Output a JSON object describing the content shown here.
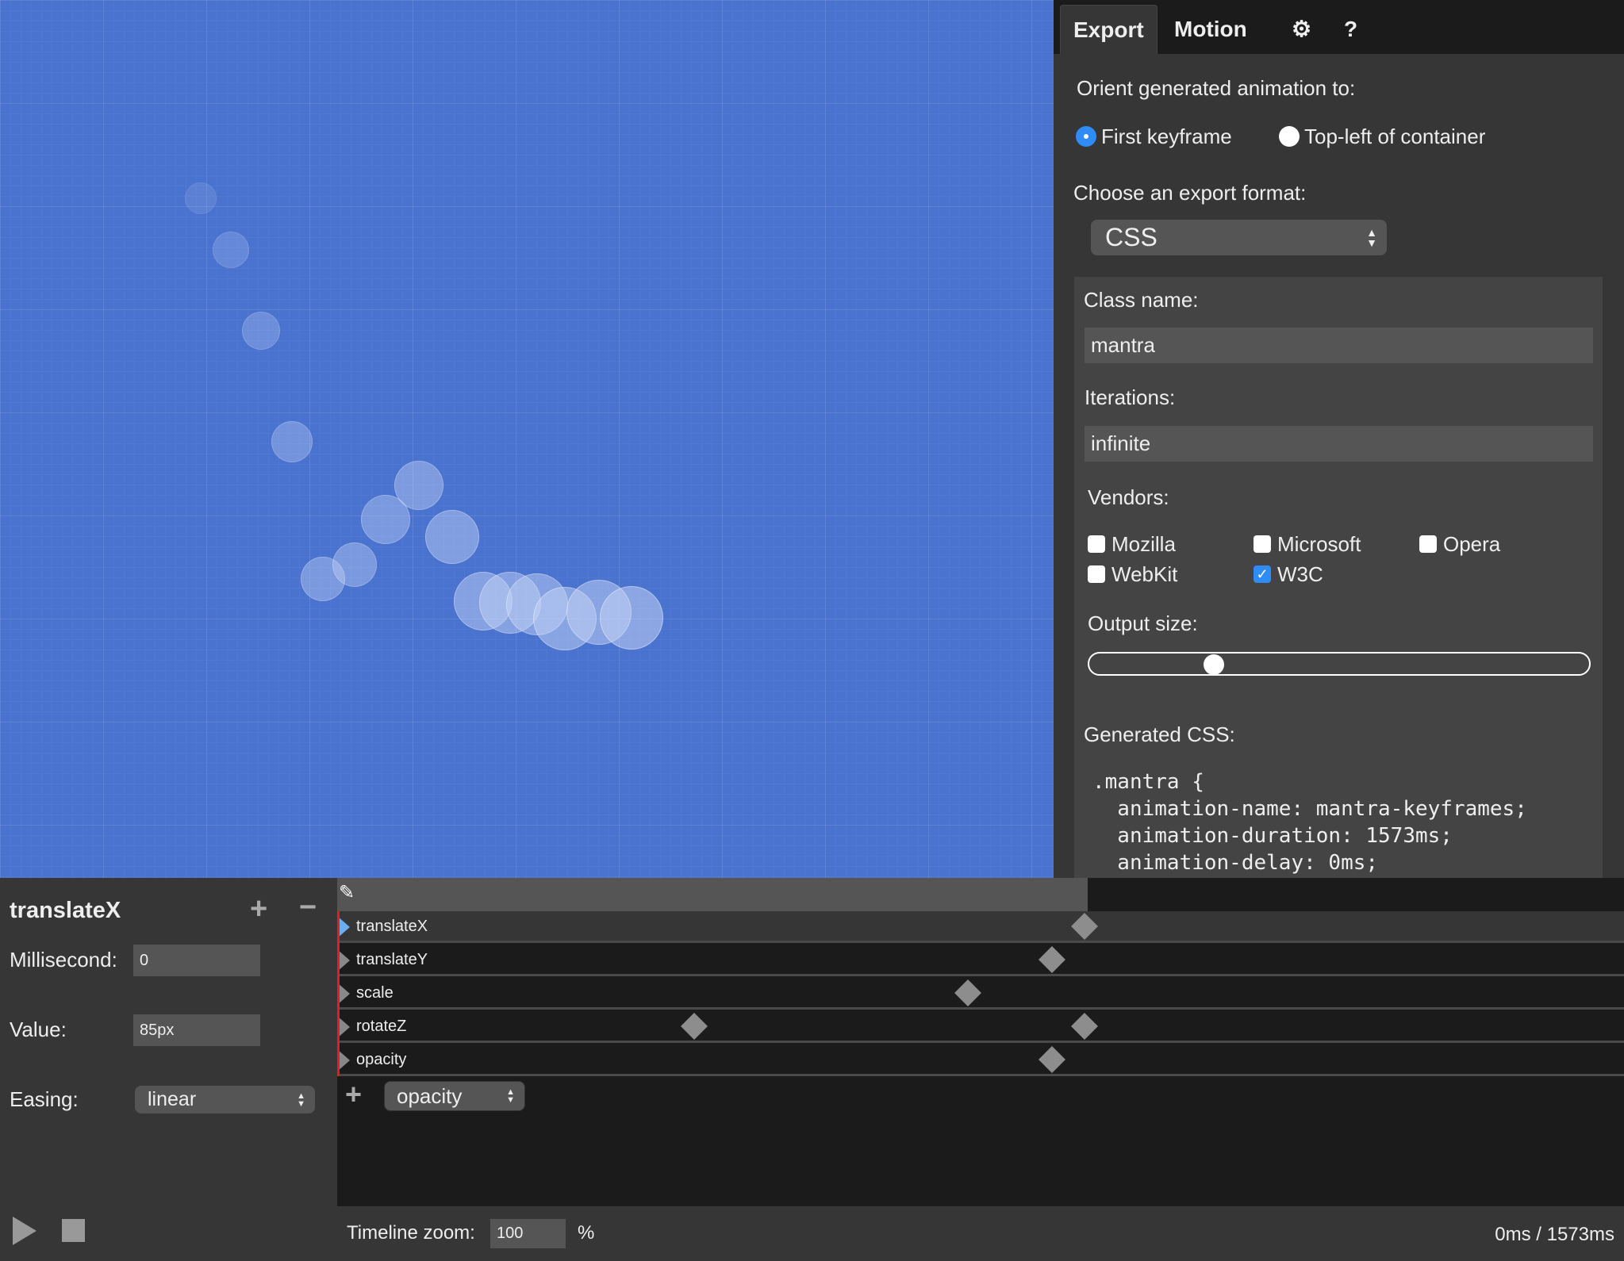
{
  "tabs": [
    {
      "label": "Export",
      "active": true
    },
    {
      "label": "Motion"
    },
    {
      "icon": "gear-icon"
    },
    {
      "label": "?"
    }
  ],
  "export": {
    "orient_label": "Orient generated animation to:",
    "orient_options": [
      {
        "label": "First keyframe",
        "checked": true
      },
      {
        "label": "Top-left of container",
        "checked": false
      }
    ],
    "format_label": "Choose an export format:",
    "format_value": "CSS",
    "class_label": "Class name:",
    "class_value": "mantra",
    "iterations_label": "Iterations:",
    "iterations_value": "infinite",
    "vendors_label": "Vendors:",
    "vendors": [
      {
        "label": "Mozilla",
        "checked": false
      },
      {
        "label": "Microsoft",
        "checked": false
      },
      {
        "label": "Opera",
        "checked": false
      },
      {
        "label": "WebKit",
        "checked": false
      },
      {
        "label": "W3C",
        "checked": true
      }
    ],
    "output_size_label": "Output size:",
    "output_size_fraction": 0.25,
    "generated_label": "Generated CSS:",
    "code_lines": [
      ".mantra {",
      "  animation-name: mantra-keyframes;",
      "  animation-duration: 1573ms;",
      "  animation-delay: 0ms;"
    ]
  },
  "keyframe_editor": {
    "title": "translateX",
    "ms_label": "Millisecond:",
    "ms_value": "0",
    "value_label": "Value:",
    "value_value": "85px",
    "easing_label": "Easing:",
    "easing_value": "linear"
  },
  "timeline": {
    "duration_ms": 1573,
    "tracks": [
      {
        "name": "translateX",
        "selected": true,
        "keyframes_ms": [
          1573
        ]
      },
      {
        "name": "translateY",
        "keyframes_ms": [
          1505
        ]
      },
      {
        "name": "scale",
        "keyframes_ms": [
          1326
        ]
      },
      {
        "name": "rotateZ",
        "keyframes_ms": [
          748,
          1573
        ]
      },
      {
        "name": "opacity",
        "keyframes_ms": [
          1505
        ]
      }
    ],
    "add_property_value": "opacity",
    "zoom_label": "Timeline zoom:",
    "zoom_value": "100",
    "zoom_unit": "%",
    "time_readout": "0ms / 1573ms"
  },
  "colors": {
    "stage": "#4a72cf",
    "accent": "#2f8cf5",
    "playhead": "#e02020"
  }
}
